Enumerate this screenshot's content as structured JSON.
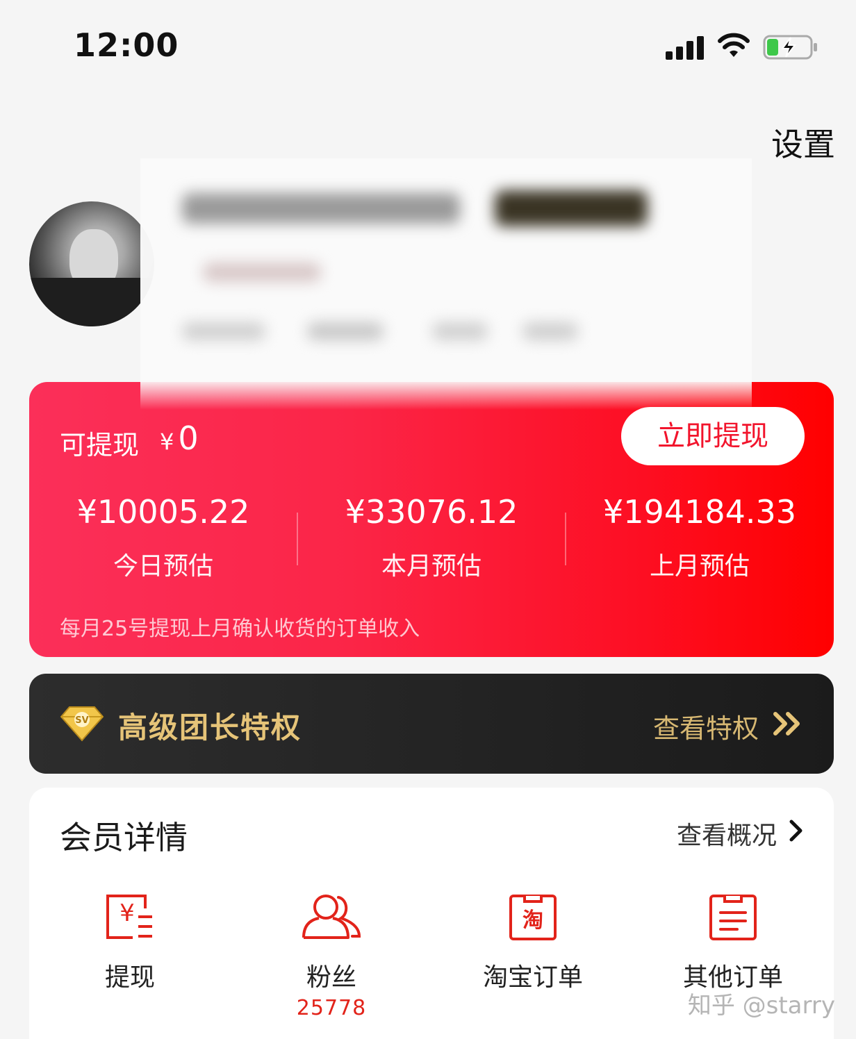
{
  "status_bar": {
    "time": "12:00"
  },
  "header": {
    "settings_label": "设置"
  },
  "earnings": {
    "available_label": "可提现",
    "available_currency": "¥",
    "available_amount": "0",
    "withdraw_button": "立即提现",
    "stats": [
      {
        "value": "¥10005.22",
        "label": "今日预估"
      },
      {
        "value": "¥33076.12",
        "label": "本月预估"
      },
      {
        "value": "¥194184.33",
        "label": "上月预估"
      }
    ],
    "note": "每月25号提现上月确认收货的订单收入"
  },
  "privilege": {
    "title": "高级团长特权",
    "link_label": "查看特权",
    "icon": "diamond-icon",
    "accent_color": "#e6c478"
  },
  "member": {
    "title": "会员详情",
    "overview_label": "查看概况",
    "items": [
      {
        "label": "提现",
        "icon": "withdraw-yen-icon"
      },
      {
        "label": "粉丝",
        "count": "25778",
        "icon": "fans-icon"
      },
      {
        "label": "淘宝订单",
        "icon": "taobao-order-icon",
        "icon_text": "淘"
      },
      {
        "label": "其他订单",
        "icon": "other-order-icon"
      }
    ]
  },
  "watermark": "知乎 @starry",
  "colors": {
    "brand_red": "#f2142c",
    "card_gradient_start": "#fb2f59",
    "card_gradient_end": "#ff0000"
  }
}
